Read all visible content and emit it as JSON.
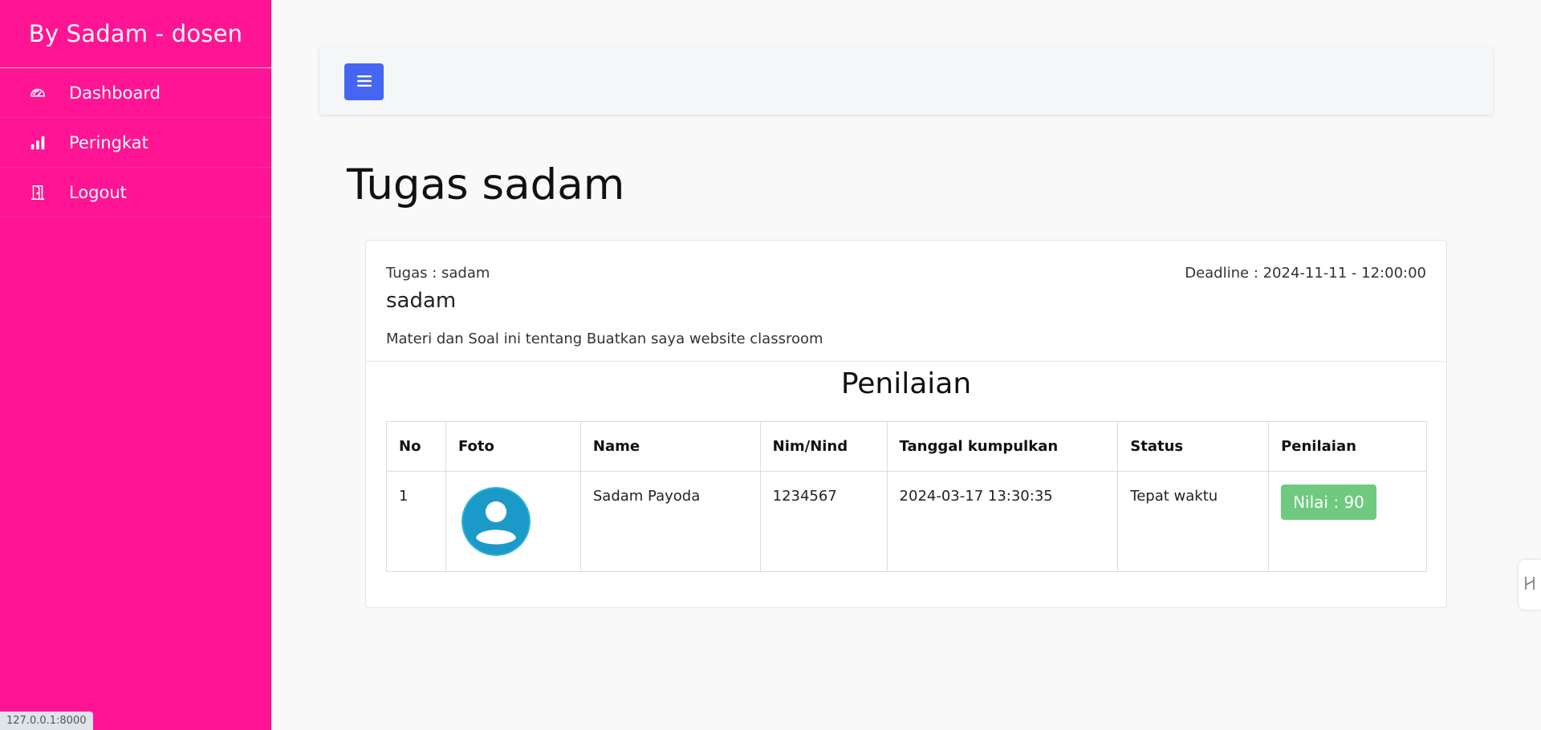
{
  "sidebar": {
    "brand": "By Sadam - dosen",
    "items": [
      {
        "label": "Dashboard",
        "icon": "speedometer-icon"
      },
      {
        "label": "Peringkat",
        "icon": "bar-chart-icon"
      },
      {
        "label": "Logout",
        "icon": "door-exit-icon"
      }
    ],
    "color": "#ff1493"
  },
  "topbar": {
    "toggle_icon": "menu-icon",
    "toggle_color": "#4466f2"
  },
  "page": {
    "title": "Tugas sadam"
  },
  "card": {
    "tugas_label": "Tugas : sadam",
    "deadline": "Deadline : 2024-11-11 - 12:00:00",
    "subtitle": "sadam",
    "description": "Materi dan Soal ini tentang Buatkan saya website classroom",
    "section_title": "Penilaian"
  },
  "table": {
    "headers": [
      "No",
      "Foto",
      "Name",
      "Nim/Nind",
      "Tanggal kumpulkan",
      "Status",
      "Penilaian"
    ],
    "rows": [
      {
        "no": "1",
        "foto": "user-avatar-icon",
        "name": "Sadam Payoda",
        "nim": "1234567",
        "tanggal": "2024-03-17 13:30:35",
        "status": "Tepat waktu",
        "penilaian": "Nilai : 90"
      }
    ]
  },
  "status_color": "#28a745",
  "url_hint": "127.0.0.1:8000"
}
